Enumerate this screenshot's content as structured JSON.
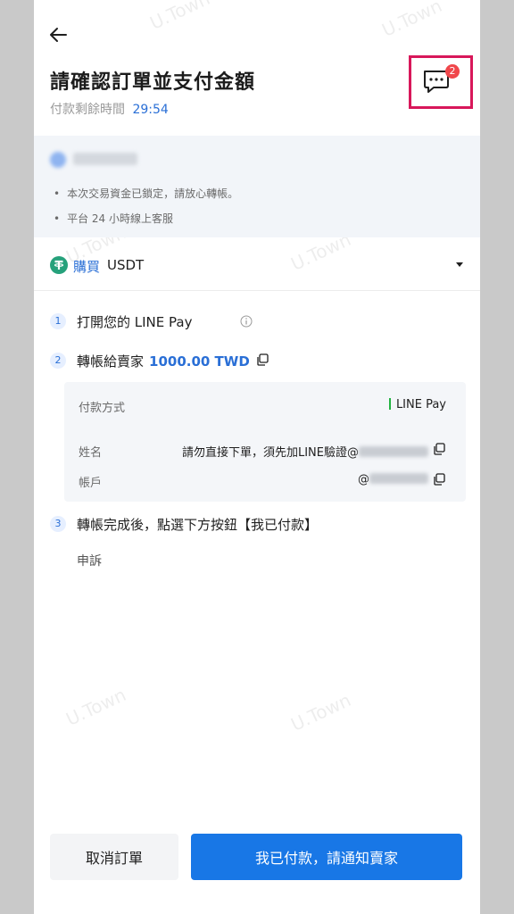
{
  "header": {
    "title": "請確認訂單並支付金額",
    "timer_label": "付款剩餘時間",
    "timer_value": "29:54",
    "chat_badge_count": "2"
  },
  "notice": {
    "items": [
      "本次交易資金已鎖定，請放心轉帳。",
      "平台 24 小時線上客服"
    ]
  },
  "asset": {
    "action": "購買",
    "coin": "USDT"
  },
  "steps": [
    {
      "number": "1",
      "text": "打開您的 LINE Pay"
    },
    {
      "number": "2",
      "text": "轉帳給賣家",
      "amount": "1000.00 TWD"
    },
    {
      "number": "3",
      "text": "轉帳完成後，點選下方按鈕【我已付款】"
    }
  ],
  "payment_card": {
    "method_label": "付款方式",
    "method_value": "LINE Pay",
    "name_label": "姓名",
    "name_value": "請勿直接下單，須先加LINE驗證@",
    "account_label": "帳戶",
    "account_value": "@"
  },
  "appeal_label": "申訴",
  "watermark_text": "U.Town",
  "buttons": {
    "cancel": "取消訂單",
    "confirm": "我已付款，請通知賣家"
  },
  "colors": {
    "accent": "#1877e6",
    "link_blue": "#2a6fd6",
    "badge": "#f0474b",
    "highlight": "#d8175a",
    "line_green": "#22b341",
    "usdt_green": "#26a17b"
  }
}
